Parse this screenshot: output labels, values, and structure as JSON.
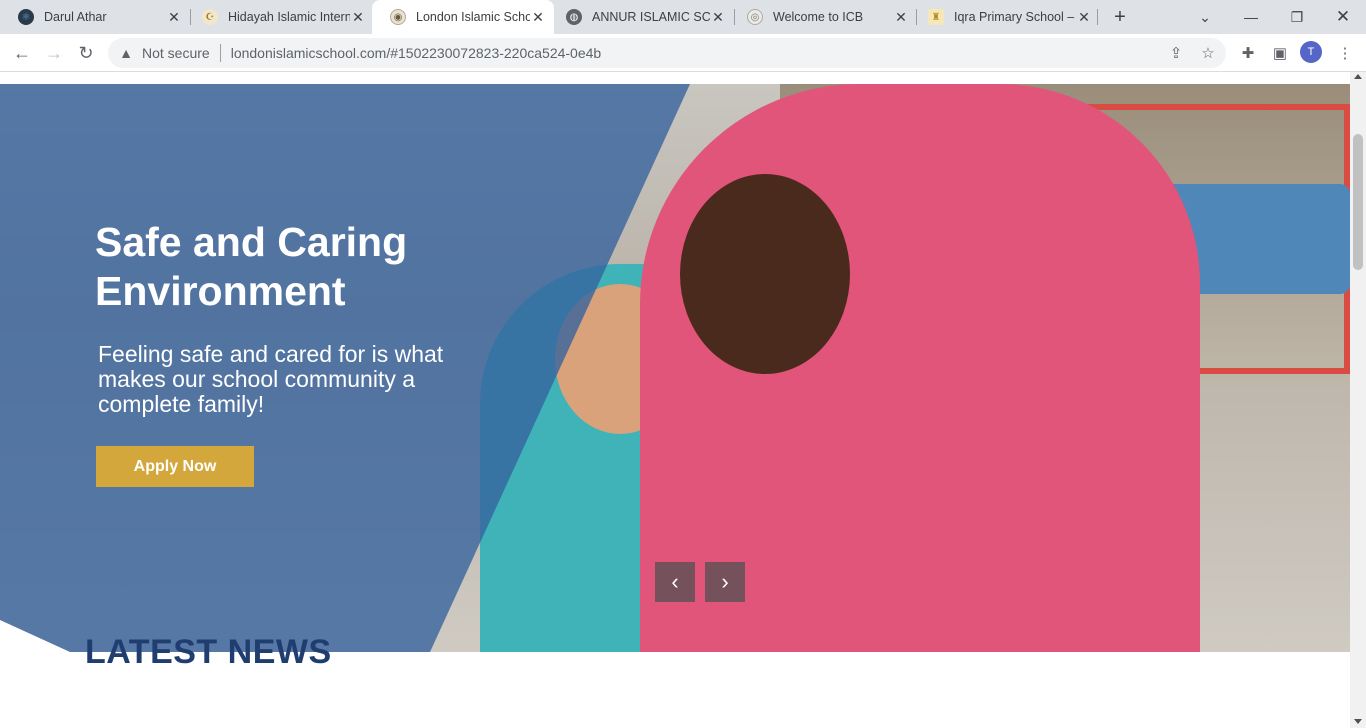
{
  "browser": {
    "tabs": [
      {
        "title": "Darul Athar",
        "icon": "atom-icon",
        "active": false
      },
      {
        "title": "Hidayah Islamic Intern",
        "icon": "hidayah-logo-icon",
        "active": false
      },
      {
        "title": "London Islamic Schoo",
        "icon": "school-crest-icon",
        "active": true
      },
      {
        "title": "ANNUR ISLAMIC SCH",
        "icon": "globe-icon",
        "active": false
      },
      {
        "title": "Welcome to ICB",
        "icon": "icb-crest-icon",
        "active": false
      },
      {
        "title": "Iqra Primary School –",
        "icon": "iqra-logo-icon",
        "active": false
      }
    ],
    "security_label": "Not secure",
    "url": "londonislamicschool.com/#1502230072823-220ca524-0e4b",
    "profile_initial": "T"
  },
  "hero": {
    "heading": "Safe and Caring Environment",
    "subheading": "Feeling safe and cared for is what makes our school community a complete family!",
    "cta_label": "Apply Now",
    "prev_label": "‹",
    "next_label": "›"
  },
  "sections": {
    "news_title": "LATEST NEWS"
  },
  "colors": {
    "overlay_blue": "#34629e",
    "cta_gold": "#d3a73c",
    "news_title": "#1f3e6f"
  }
}
